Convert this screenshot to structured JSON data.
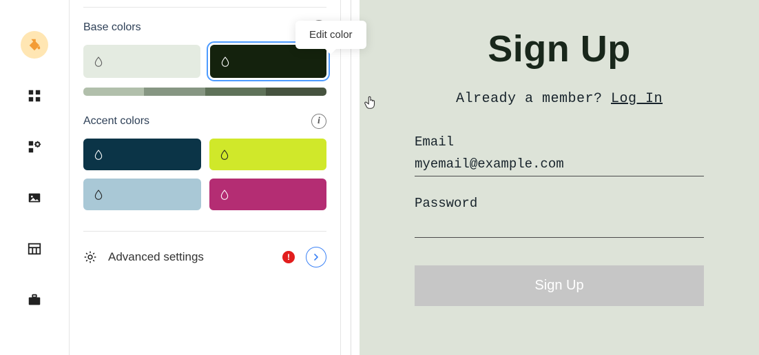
{
  "tooltip": "Edit color",
  "sections": {
    "base": {
      "title": "Base colors"
    },
    "accent": {
      "title": "Accent colors"
    },
    "advanced": {
      "label": "Advanced settings"
    }
  },
  "base_colors": [
    {
      "hex": "#e4ebe1",
      "icon_fill": "#5b5b5b"
    },
    {
      "hex": "#14220d",
      "icon_fill": "#ffffff",
      "selected": true
    }
  ],
  "shade_strip": [
    "#b1bfab",
    "#869682",
    "#5f7259",
    "#46533f"
  ],
  "accent_colors": [
    {
      "hex": "#0b3447",
      "icon_fill": "#ffffff"
    },
    {
      "hex": "#d0e82a",
      "icon_fill": "#222222"
    },
    {
      "hex": "#a9c8d6",
      "icon_fill": "#222222"
    },
    {
      "hex": "#b42d73",
      "icon_fill": "#ffffff"
    }
  ],
  "alert_icon_text": "!",
  "info_icon_text": "i",
  "preview": {
    "title": "Sign Up",
    "member_text": "Already a member? ",
    "login_link": "Log In",
    "email_label": "Email",
    "email_value": "myemail@example.com",
    "password_label": "Password",
    "password_value": "",
    "button_label": "Sign Up"
  }
}
